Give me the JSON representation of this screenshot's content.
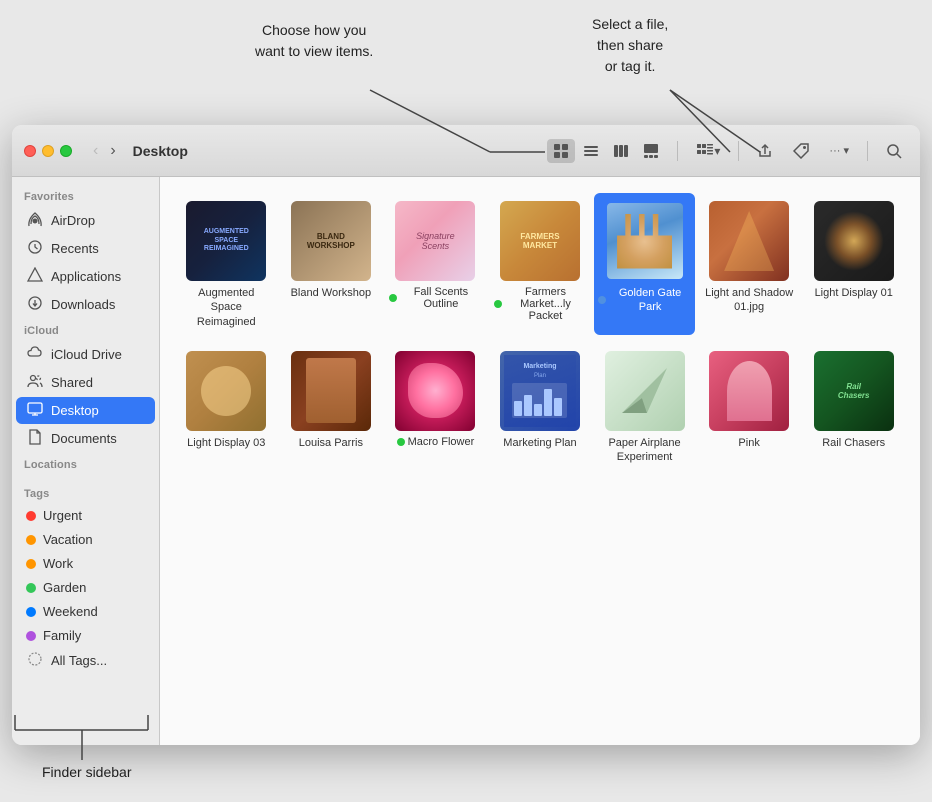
{
  "window": {
    "title": "Desktop"
  },
  "annotations": {
    "left_callout": "Choose how you\nwant to view items.",
    "right_callout": "Select a file,\nthen share\nor tag it.",
    "bottom_label": "Finder sidebar"
  },
  "toolbar": {
    "back_label": "‹",
    "forward_label": "›",
    "view_icons": [
      "⊞",
      "≡",
      "⊟",
      "▣"
    ],
    "group_btn": "⊞≡",
    "share_label": "⬆",
    "tag_label": "⬡",
    "more_label": "···",
    "search_label": "🔍"
  },
  "sidebar": {
    "favorites_label": "Favorites",
    "icloud_label": "iCloud",
    "locations_label": "Locations",
    "tags_label": "Tags",
    "favorites": [
      {
        "id": "airdrop",
        "label": "AirDrop",
        "icon": "📡"
      },
      {
        "id": "recents",
        "label": "Recents",
        "icon": "🕐"
      },
      {
        "id": "applications",
        "label": "Applications",
        "icon": "🚀"
      },
      {
        "id": "downloads",
        "label": "Downloads",
        "icon": "⬇"
      }
    ],
    "icloud": [
      {
        "id": "icloud-drive",
        "label": "iCloud Drive",
        "icon": "☁"
      },
      {
        "id": "shared",
        "label": "Shared",
        "icon": "👥"
      },
      {
        "id": "desktop",
        "label": "Desktop",
        "icon": "🖥",
        "active": true
      },
      {
        "id": "documents",
        "label": "Documents",
        "icon": "📄"
      }
    ],
    "tags": [
      {
        "id": "urgent",
        "label": "Urgent",
        "color": "#ff3b30"
      },
      {
        "id": "vacation",
        "label": "Vacation",
        "color": "#ff9500"
      },
      {
        "id": "work",
        "label": "Work",
        "color": "#ff9500"
      },
      {
        "id": "garden",
        "label": "Garden",
        "color": "#34c759"
      },
      {
        "id": "weekend",
        "label": "Weekend",
        "color": "#007aff"
      },
      {
        "id": "family",
        "label": "Family",
        "color": "#af52de"
      },
      {
        "id": "all-tags",
        "label": "All Tags...",
        "color": null
      }
    ]
  },
  "files": {
    "row1": [
      {
        "id": "augmented",
        "name": "Augmented\nSpace Reimagined",
        "thumb_type": "aug",
        "has_dot": false,
        "selected": false
      },
      {
        "id": "bland",
        "name": "Bland Workshop",
        "thumb_type": "bland",
        "has_dot": false,
        "selected": false
      },
      {
        "id": "fall-scents",
        "name": "Fall Scents\nOutline",
        "thumb_type": "fall",
        "has_dot": true,
        "selected": false
      },
      {
        "id": "farmers",
        "name": "Farmers\nMarket...ly Packet",
        "thumb_type": "farmers",
        "has_dot": true,
        "selected": false
      },
      {
        "id": "golden-gate",
        "name": "Golden Gate\nPark",
        "thumb_type": "golden",
        "has_dot": false,
        "selected": true
      },
      {
        "id": "light-shadow",
        "name": "Light and Shadow\n01.jpg",
        "thumb_type": "light-shadow",
        "has_dot": false,
        "selected": false
      },
      {
        "id": "light01",
        "name": "Light Display 01",
        "thumb_type": "light01",
        "has_dot": false,
        "selected": false
      }
    ],
    "row2": [
      {
        "id": "light03",
        "name": "Light Display 03",
        "thumb_type": "light03",
        "has_dot": false,
        "selected": false
      },
      {
        "id": "louisa",
        "name": "Louisa Parris",
        "thumb_type": "louisa",
        "has_dot": false,
        "selected": false
      },
      {
        "id": "macro",
        "name": "Macro Flower",
        "thumb_type": "macro",
        "has_dot": true,
        "selected": false
      },
      {
        "id": "marketing",
        "name": "Marketing Plan",
        "thumb_type": "marketing",
        "has_dot": false,
        "selected": false
      },
      {
        "id": "paper",
        "name": "Paper Airplane\nExperiment",
        "thumb_type": "paper",
        "has_dot": false,
        "selected": false
      },
      {
        "id": "pink",
        "name": "Pink",
        "thumb_type": "pink",
        "has_dot": false,
        "selected": false
      },
      {
        "id": "rail",
        "name": "Rail Chasers",
        "thumb_type": "rail",
        "has_dot": false,
        "selected": false
      }
    ]
  }
}
